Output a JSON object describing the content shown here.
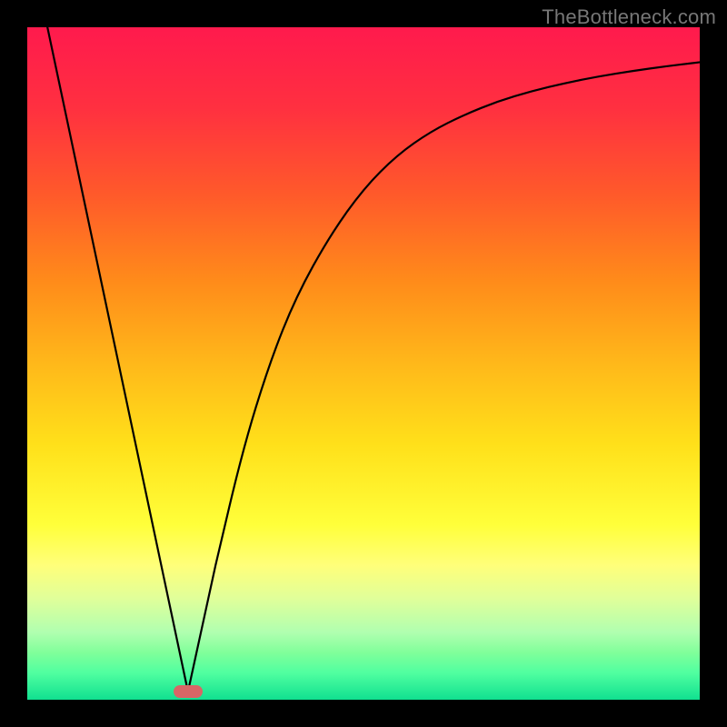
{
  "watermark": "TheBottleneck.com",
  "chart_data": {
    "type": "line",
    "title": "",
    "xlabel": "",
    "ylabel": "",
    "xlim": [
      0,
      1
    ],
    "ylim": [
      0,
      1
    ],
    "grid": false,
    "series": [
      {
        "name": "left-descent",
        "x": [
          0.03,
          0.239
        ],
        "values": [
          1.0,
          0.012
        ]
      },
      {
        "name": "right-curve",
        "x": [
          0.239,
          0.28,
          0.32,
          0.36,
          0.4,
          0.45,
          0.5,
          0.55,
          0.6,
          0.65,
          0.7,
          0.75,
          0.8,
          0.85,
          0.9,
          0.95,
          1.0
        ],
        "values": [
          0.012,
          0.2,
          0.37,
          0.5,
          0.6,
          0.69,
          0.76,
          0.81,
          0.845,
          0.87,
          0.89,
          0.905,
          0.917,
          0.927,
          0.935,
          0.942,
          0.948
        ]
      }
    ],
    "annotations": [
      {
        "type": "marker",
        "shape": "pill",
        "x": 0.239,
        "y": 0.012,
        "color": "#d86666"
      }
    ],
    "background": {
      "type": "vertical-gradient",
      "stops": [
        {
          "pos": 0.0,
          "color": "#ff1a4d"
        },
        {
          "pos": 0.5,
          "color": "#ffb81a"
        },
        {
          "pos": 0.8,
          "color": "#ffff7a"
        },
        {
          "pos": 1.0,
          "color": "#10e090"
        }
      ]
    }
  }
}
